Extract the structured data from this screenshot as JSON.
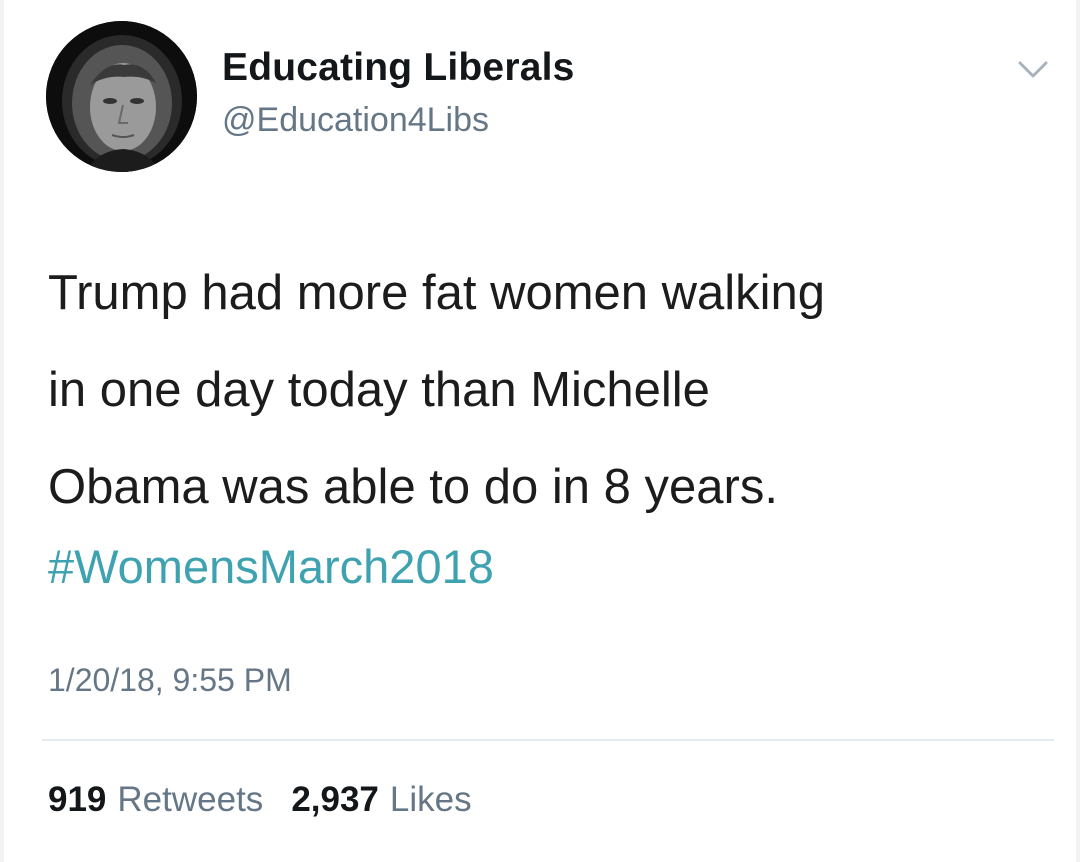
{
  "tweet": {
    "author_name": "Educating Liberals",
    "author_handle": "@Education4Libs",
    "text_lines": [
      "Trump had more fat women walking",
      "in one day today than Michelle",
      "Obama was able to do in 8 years."
    ],
    "hashtag": "#WomensMarch2018",
    "timestamp": "1/20/18, 9:55 PM",
    "retweet_count": "919",
    "retweet_label": "Retweets",
    "like_count": "2,937",
    "like_label": "Likes"
  },
  "colors": {
    "hashtag": "#3fa2b0",
    "secondary_text": "#657786",
    "primary_text": "#14171a",
    "divider": "#e6ecf0"
  },
  "icons": {
    "caret": "chevron-down-icon",
    "avatar": "avatar"
  }
}
